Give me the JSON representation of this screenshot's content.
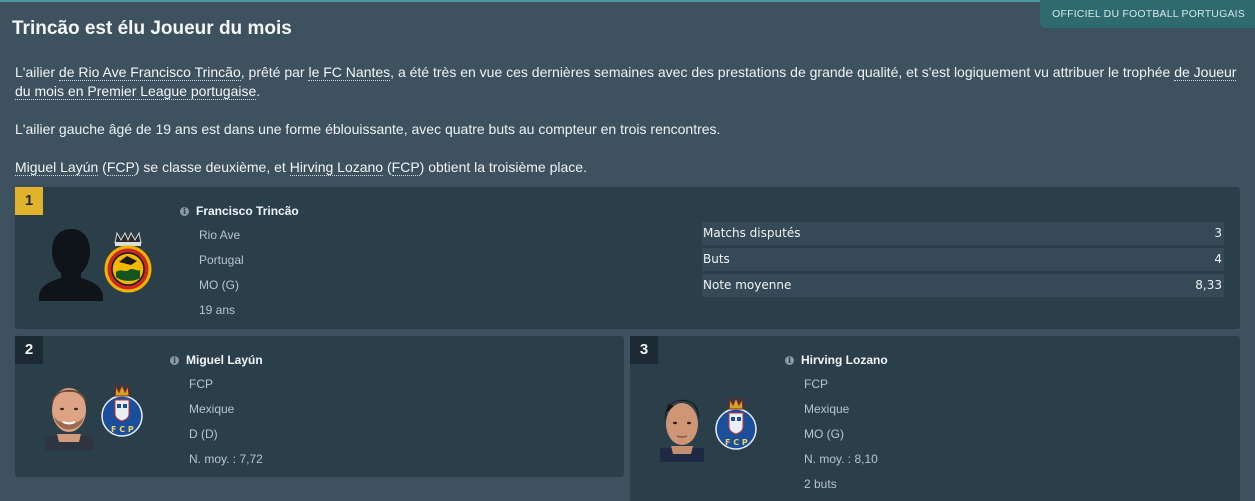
{
  "header": {
    "source": "OFFICIEL DU FOOTBALL PORTUGAIS",
    "title": "Trincão est élu Joueur du mois"
  },
  "article": {
    "p1": {
      "t1": "L'ailier ",
      "l1": "de Rio Ave Francisco Trincão",
      "t2": ", prêté par ",
      "l2": "le FC Nantes",
      "t3": ", a été très en vue ces dernières semaines avec des prestations de grande qualité, et s'est logiquement vu attribuer le trophée ",
      "l3": "de Joueur du mois en Premier League portugaise",
      "t4": "."
    },
    "p2": "L'ailier gauche âgé de 19 ans est dans une forme éblouissante, avec quatre buts au compteur en trois rencontres.",
    "p3": {
      "l1": "Miguel Layún",
      "t1": " (",
      "l2": "FCP",
      "t2": ") se classe deuxième, et ",
      "l3": "Hirving Lozano",
      "t3": " (",
      "l4": "FCP",
      "t4": ") obtient la troisième place."
    }
  },
  "winner": {
    "rank": "1",
    "name": "Francisco Trincão",
    "club": "Rio Ave",
    "nation": "Portugal",
    "position": "MO (G)",
    "age": "19 ans",
    "stats": [
      {
        "label": "Matchs disputés",
        "value": "3"
      },
      {
        "label": "Buts",
        "value": "4"
      },
      {
        "label": "Note moyenne",
        "value": "8,33"
      }
    ]
  },
  "second": {
    "rank": "2",
    "name": "Miguel Layún",
    "club": "FCP",
    "nation": "Mexique",
    "position": "D (D)",
    "rating": "N. moy. : 7,72"
  },
  "third": {
    "rank": "3",
    "name": "Hirving Lozano",
    "club": "FCP",
    "nation": "Mexique",
    "position": "MO (G)",
    "rating": "N. moy. : 8,10",
    "goals": "2 buts"
  },
  "colors": {
    "background": "#3d525e",
    "card": "#2b3f4b",
    "gold": "#e1b32c",
    "accent": "#2f6a71"
  },
  "icons": [
    "info-icon",
    "player-silhouette",
    "player-photo",
    "rio-ave-crest",
    "fc-porto-crest"
  ]
}
